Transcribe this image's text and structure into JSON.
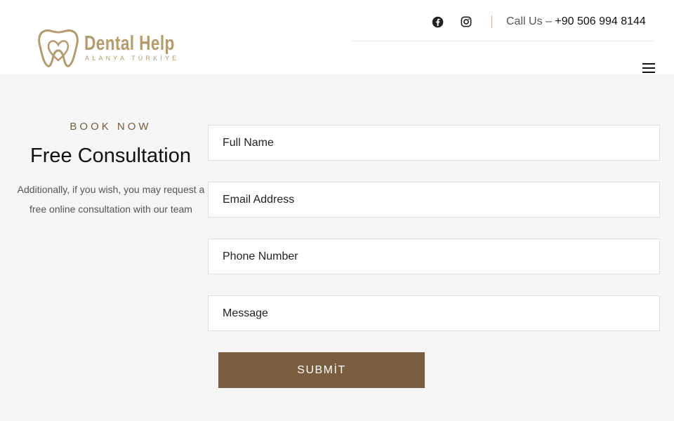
{
  "header": {
    "logo": {
      "name": "Dental Help",
      "tagline": "ALANYA TÜRKİYE",
      "icon": "tooth-heart-logo"
    },
    "social": [
      {
        "icon": "facebook-icon"
      },
      {
        "icon": "instagram-icon"
      }
    ],
    "call_label": "Call Us – ",
    "phone": "+90 506 994 8144",
    "menu_icon": "hamburger-menu-icon"
  },
  "intro": {
    "eyebrow": "BOOK NOW",
    "title": "Free Consultation",
    "description": "Additionally, if you wish, you may request a free online consultation with our team"
  },
  "form": {
    "name_placeholder": "Full Name",
    "email_placeholder": "Email Address",
    "phone_placeholder": "Phone Number",
    "message_placeholder": "Message",
    "submit_label": "SUBMİT"
  },
  "colors": {
    "brand_gold": "#b49a6c",
    "button_brown": "#7a5c3f",
    "background": "#f5f5f5"
  }
}
